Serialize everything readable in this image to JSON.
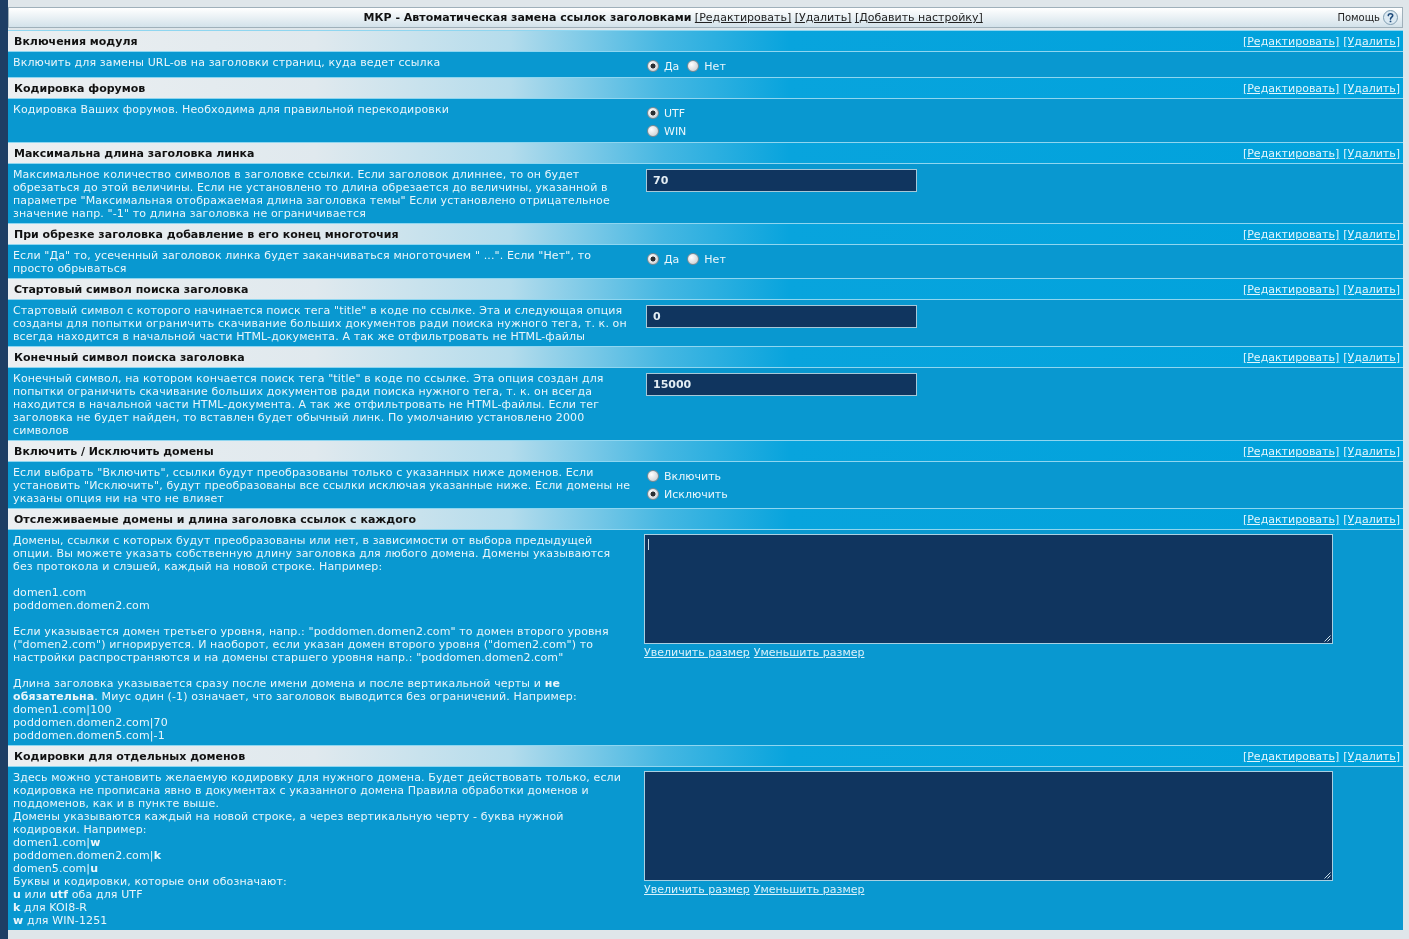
{
  "title_bar": {
    "title": "МКР - Автоматическая замена ссылок заголовками",
    "links": [
      "[Редактировать]",
      "[Удалить]",
      "[Добавить настройку]"
    ],
    "help": "Помощь"
  },
  "sections": [
    {
      "title": "Включения модуля",
      "links": [
        "[Редактировать]",
        "[Удалить]"
      ],
      "paragraphs": [
        [
          "Включить для замены URL-ов на заголовки страниц, куда ведет ссылка"
        ]
      ],
      "control": {
        "kind": "radio_row",
        "options": [
          {
            "label": "Да",
            "selected": true
          },
          {
            "label": "Нет",
            "selected": false
          }
        ]
      }
    },
    {
      "title": "Кодировка форумов",
      "links": [
        "[Редактировать]",
        "[Удалить]"
      ],
      "paragraphs": [
        [
          "Кодировка Ваших форумов. Необходима для правильной перекодировки"
        ]
      ],
      "control": {
        "kind": "radio_column",
        "options": [
          {
            "label": "UTF",
            "selected": true
          },
          {
            "label": "WIN",
            "selected": false
          }
        ]
      }
    },
    {
      "title": "Максимальна длина заголовка линка",
      "links": [
        "[Редактировать]",
        "[Удалить]"
      ],
      "paragraphs": [
        [
          "Максимальное количество символов в заголовке ссылки. Если заголовок длиннее, то он будет обрезаться до этой величины. Если не установлено то длина обрезается до величины, указанной в параметре \"Максимальная отображаемая длина заголовка темы\" Если установлено отрицательное значение напр. \"-1\" то длина заголовка не ограничивается"
        ]
      ],
      "control": {
        "kind": "text_input",
        "value": "70"
      }
    },
    {
      "title": "При обрезке заголовка добавление в его конец многоточия",
      "links": [
        "[Редактировать]",
        "[Удалить]"
      ],
      "paragraphs": [
        [
          "Если \"Да\" то, усеченный заголовок линка будет заканчиваться многоточием \" ...\". Если \"Нет\", то просто обрываться"
        ]
      ],
      "control": {
        "kind": "radio_row",
        "options": [
          {
            "label": "Да",
            "selected": true
          },
          {
            "label": "Нет",
            "selected": false
          }
        ]
      }
    },
    {
      "title": "Стартовый символ поиска заголовка",
      "links": [
        "[Редактировать]",
        "[Удалить]"
      ],
      "paragraphs": [
        [
          "Стартовый символ с которого начинается поиск тега \"title\" в коде по ссылке. Эта и следующая опция созданы для попытки ограничить скачивание больших документов ради поиска нужного тега, т. к. он всегда находится в начальной части HTML-документа. А так же отфильтровать не HTML-файлы"
        ]
      ],
      "control": {
        "kind": "text_input",
        "value": "0"
      }
    },
    {
      "title": "Конечный символ поиска заголовка",
      "links": [
        "[Редактировать]",
        "[Удалить]"
      ],
      "paragraphs": [
        [
          "Конечный символ, на котором кончается поиск тега \"title\" в коде по ссылке. Эта опция создан для попытки ограничить скачивание больших документов ради поиска нужного тега, т. к. он всегда находится в начальной части HTML-документа. А так же отфильтровать не HTML-файлы. Если тег заголовка не будет найден, то вставлен будет обычный линк. По умолчанию установлено 2000 символов"
        ]
      ],
      "control": {
        "kind": "text_input",
        "value": "15000"
      }
    },
    {
      "title": "Включить / Исключить домены",
      "links": [
        "[Редактировать]",
        "[Удалить]"
      ],
      "paragraphs": [
        [
          "Если выбрать \"Включить\", ссылки будут преобразованы только с указанных ниже доменов. Если установить \"Исключить\", будут преобразованы все ссылки исключая указанные ниже. Если домены не указаны опция ни на что не влияет"
        ]
      ],
      "control": {
        "kind": "radio_column",
        "options": [
          {
            "label": "Включить",
            "selected": false
          },
          {
            "label": "Исключить",
            "selected": true
          }
        ]
      }
    },
    {
      "title": "Отслеживаемые домены и длина заголовка ссылок с каждого",
      "links": [
        "[Редактировать]",
        "[Удалить]"
      ],
      "paragraphs": [
        [
          "Домены, ссылки с которых будут преобразованы или нет, в зависимости от выбора предыдущей опции. Вы можете указать собственную длину заголовка для любого домена. Домены указываются без протокола и слэшей, каждый на новой строке. Например:"
        ],
        [
          "domen1.com",
          "poddomen.domen2.com"
        ],
        [
          "Если указывается домен третьего уровня, напр.: \"poddomen.domen2.com\" то домен второго уровня (\"domen2.com\") игнорируется. И наоборот, если указан домен второго уровня (\"domen2.com\") то настройки распространяются и на домены старшего уровня напр.: \"poddomen.domen2.com\""
        ],
        [
          "Длина заголовка указывается сразу после имени домена и после вертикальной черты и **не обязательна**. Миус один (-1) означает, что заголовок выводится без ограничений. Например:",
          "domen1.com|100",
          "poddomen.domen2.com|70",
          "poddomen.domen5.com|-1"
        ]
      ],
      "control": {
        "kind": "textarea",
        "focused": true,
        "links": [
          "Увеличить размер",
          "Уменьшить размер"
        ]
      }
    },
    {
      "title": "Кодировки для отдельных доменов",
      "links": [
        "[Редактировать]",
        "[Удалить]"
      ],
      "paragraphs": [
        [
          "Здесь можно установить желаемую кодировку для нужного домена. Будет действовать только, если кодировка не прописана явно в документах с указанного домена Правила обработки доменов и поддоменов, как и в пункте выше.",
          "Домены указываются каждый на новой строке, а через вертикальную черту - буква нужной кодировки. Например:",
          "domen1.com|**w**",
          "poddomen.domen2.com|**k**",
          "domen5.com|**u**",
          "Буквы и кодировки, которые они обозначают:",
          "**u** или **utf** оба для UTF",
          "**k** для KOI8-R",
          "**w** для WIN-1251"
        ]
      ],
      "control": {
        "kind": "textarea",
        "focused": false,
        "links": [
          "Увеличить размер",
          "Уменьшить размер"
        ]
      }
    }
  ]
}
